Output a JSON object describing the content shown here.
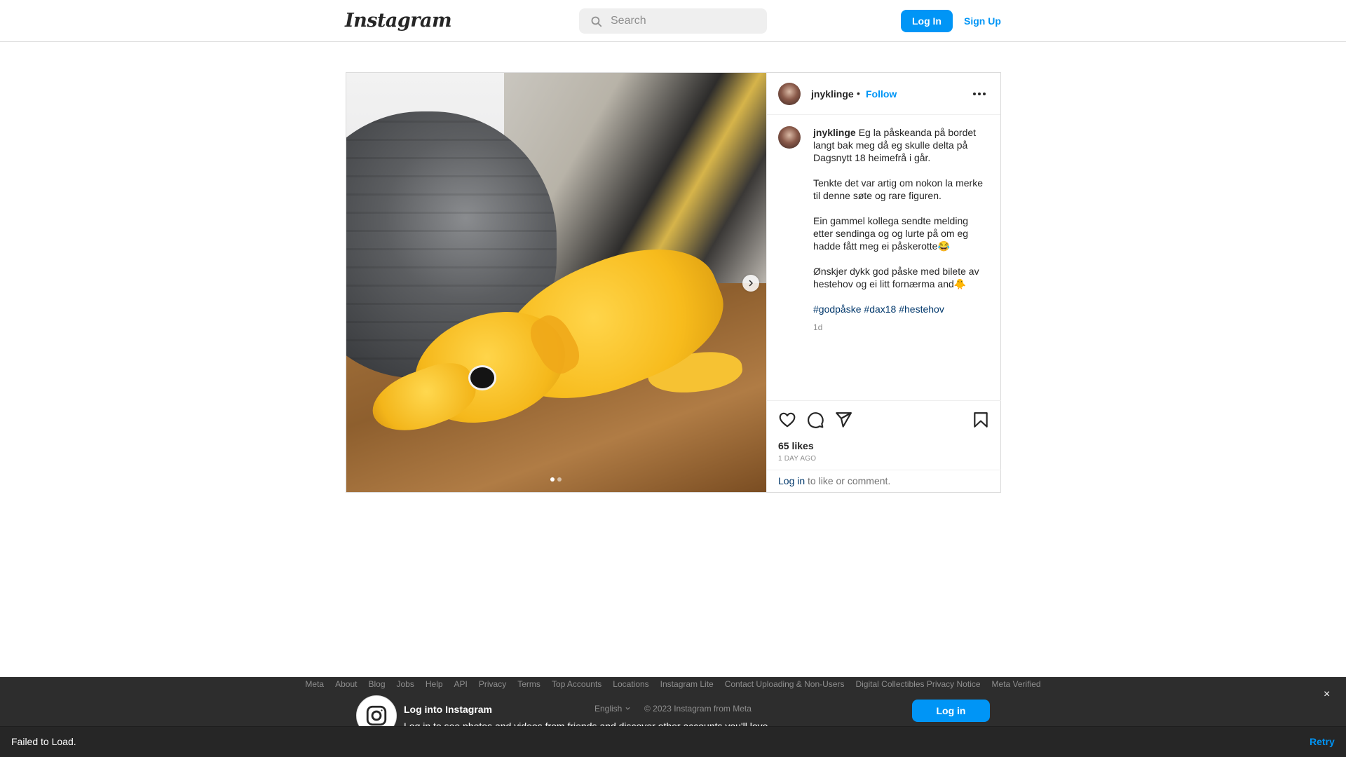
{
  "nav": {
    "logo": "Instagram",
    "search_placeholder": "Search",
    "login_label": "Log In",
    "signup_label": "Sign Up"
  },
  "post": {
    "username": "jnyklinge",
    "bullet": "•",
    "follow_label": "Follow",
    "caption": {
      "username": "jnyklinge",
      "first_paragraph": "Eg la påskeanda på bordet langt bak meg då eg skulle delta på Dagsnytt 18 heimefrå i går.",
      "paragraphs": [
        "Tenkte det var artig om nokon la merke til denne søte og rare figuren.",
        "Ein gammel kollega sendte melding etter sendinga og og lurte på om eg hadde fått meg ei påskerotte😂",
        "Ønskjer dykk god påske med bilete av hestehov og ei litt fornærma and🐥"
      ],
      "hashtags": [
        "#godpåske",
        "#dax18",
        "#hestehov"
      ],
      "age": "1d"
    },
    "likes": "65 likes",
    "posted_ago": "1 DAY AGO",
    "login_prompt": {
      "link": "Log in",
      "rest": " to like or comment."
    },
    "carousel": {
      "total": 2,
      "active_index": 0
    }
  },
  "footer": {
    "links": [
      "Meta",
      "About",
      "Blog",
      "Jobs",
      "Help",
      "API",
      "Privacy",
      "Terms",
      "Top Accounts",
      "Locations",
      "Instagram Lite",
      "Contact Uploading & Non-Users",
      "Digital Collectibles Privacy Notice",
      "Meta Verified"
    ],
    "language": "English",
    "copyright": "© 2023 Instagram from Meta"
  },
  "login_overlay": {
    "title": "Log into Instagram",
    "subtitle": "Log in to see photos and videos from friends and discover other accounts you'll love.",
    "button_label": "Log in",
    "close": "×"
  },
  "toast": {
    "message": "Failed to Load.",
    "action": "Retry"
  },
  "colors": {
    "accent": "#0095f6",
    "link": "#00376b",
    "overlay": "#262626"
  },
  "icons": [
    "search-icon",
    "chevron-right-icon",
    "more-icon",
    "heart-icon",
    "comment-icon",
    "share-icon",
    "bookmark-icon",
    "instagram-icon",
    "chevron-down-icon",
    "close-icon"
  ]
}
